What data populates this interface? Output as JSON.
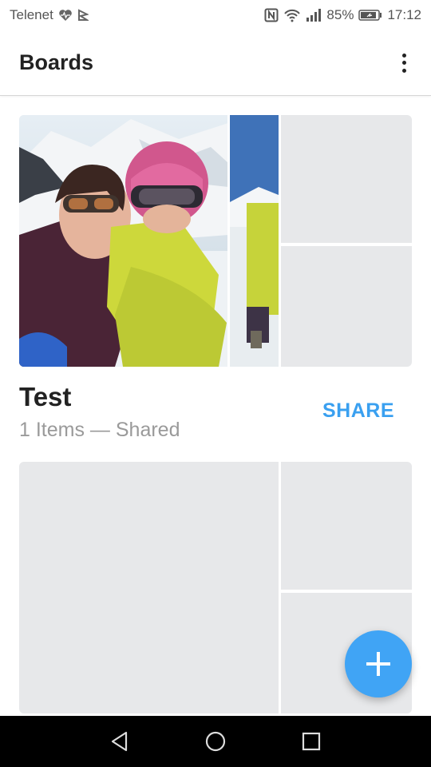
{
  "status_bar": {
    "carrier": "Telenet",
    "battery": "85%",
    "time": "17:12"
  },
  "app_bar": {
    "title": "Boards",
    "menu_icon": "more-vert-icon"
  },
  "boards": [
    {
      "name": "Test",
      "meta": "1 Items — Shared",
      "action": "SHARE",
      "has_photo": true
    },
    {
      "name": "",
      "meta": "",
      "action": "",
      "has_photo": false
    }
  ],
  "fab": {
    "icon": "plus-icon"
  },
  "nav_bar": {
    "icons": [
      "back-icon",
      "home-icon",
      "recents-icon"
    ]
  },
  "colors": {
    "accent": "#3aa0f0",
    "tile_placeholder": "#e7e8ea",
    "fab": "#40a4f5"
  }
}
